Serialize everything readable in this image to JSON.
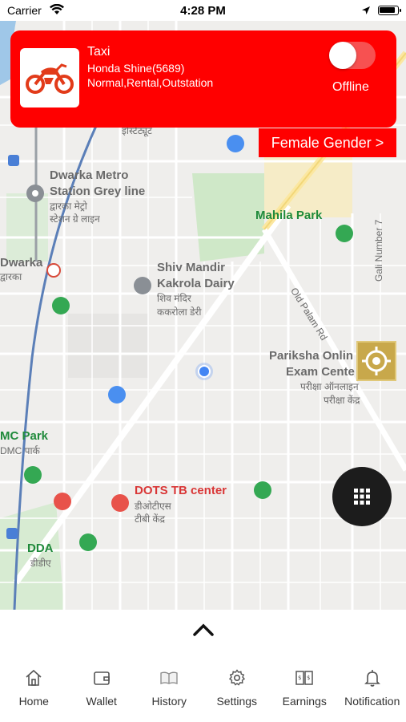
{
  "status_bar": {
    "carrier": "Carrier",
    "time": "4:28 PM"
  },
  "driver_card": {
    "service": "Taxi",
    "vehicle": "Honda Shine(5689)",
    "categories": "Normal,Rental,Outstation",
    "status": "Offline",
    "accent": "#ff0000"
  },
  "gender_button": {
    "label": "Female Gender >"
  },
  "map": {
    "labels": [
      {
        "text": "Dwarka Metro",
        "cls": "grey"
      },
      {
        "text": "Station Grey line",
        "cls": "grey"
      },
      {
        "text": "द्वारका मेट्रो",
        "cls": "sub"
      },
      {
        "text": "स्टेशन ग्रे लाइन",
        "cls": "sub"
      },
      {
        "text": "Mahila Park",
        "cls": "green"
      },
      {
        "text": "Dwarka",
        "cls": "grey"
      },
      {
        "text": "द्वारका",
        "cls": "sub"
      },
      {
        "text": "Shiv Mandir",
        "cls": "grey"
      },
      {
        "text": "Kakrola Dairy",
        "cls": "grey"
      },
      {
        "text": "शिव मंदिर",
        "cls": "sub"
      },
      {
        "text": "ककरोला डेरी",
        "cls": "sub"
      },
      {
        "text": "Old Palam Rd",
        "cls": "sub"
      },
      {
        "text": "Gali Number 7",
        "cls": "sub"
      },
      {
        "text": "Pariksha Onlin",
        "cls": "grey"
      },
      {
        "text": "Exam Cente",
        "cls": "grey"
      },
      {
        "text": "परीक्षा ऑनलाइन",
        "cls": "sub"
      },
      {
        "text": "परीक्षा केंद्र",
        "cls": "sub"
      },
      {
        "text": "MC Park",
        "cls": "green"
      },
      {
        "text": "DMC पार्क",
        "cls": "sub"
      },
      {
        "text": "DOTS TB center",
        "cls": "red"
      },
      {
        "text": "डीओटीएस",
        "cls": "sub"
      },
      {
        "text": "टीबी केंद्र",
        "cls": "sub"
      },
      {
        "text": "DDA",
        "cls": "green"
      },
      {
        "text": "डीडीए",
        "cls": "sub"
      },
      {
        "text": "इंस्टिट्यूट",
        "cls": "sub"
      }
    ]
  },
  "tabs": [
    {
      "label": "Home",
      "icon": "home-icon"
    },
    {
      "label": "Wallet",
      "icon": "wallet-icon"
    },
    {
      "label": "History",
      "icon": "book-icon"
    },
    {
      "label": "Settings",
      "icon": "gear-icon"
    },
    {
      "label": "Earnings",
      "icon": "earnings-icon"
    },
    {
      "label": "Notification",
      "icon": "bell-icon"
    }
  ]
}
